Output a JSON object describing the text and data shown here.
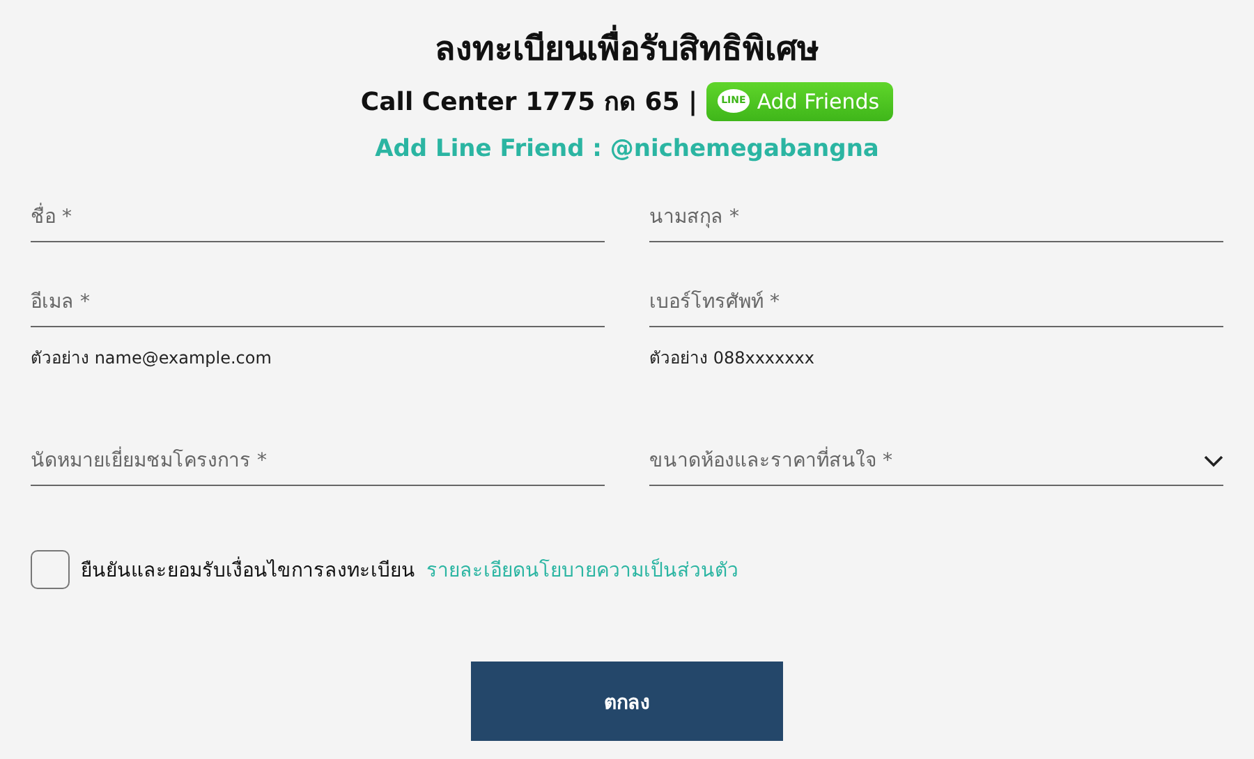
{
  "header": {
    "title": "ลงทะเบียนเพื่อรับสิทธิพิเศษ",
    "call_center": "Call Center 1775 กด 65 |",
    "line_button": {
      "logo": "LINE",
      "label": "Add Friends"
    },
    "line_id": "Add Line Friend : @nichemegabangna"
  },
  "fields": [
    {
      "kind": "text",
      "placeholder": "ชื่อ *"
    },
    {
      "kind": "text",
      "placeholder": "นามสกุล *"
    },
    {
      "kind": "text",
      "placeholder": "อีเมล *",
      "hint": "ตัวอย่าง name@example.com"
    },
    {
      "kind": "text",
      "placeholder": "เบอร์โทรศัพท์ *",
      "hint": "ตัวอย่าง 088xxxxxxx"
    },
    {
      "kind": "text",
      "placeholder": "นัดหมายเยี่ยมชมโครงการ *"
    },
    {
      "kind": "select",
      "placeholder": "ขนาดห้องและราคาที่สนใจ *"
    }
  ],
  "consent": {
    "checked": false,
    "label": "ยืนยันและยอมรับเงื่อนไขการลงทะเบียน",
    "link": "รายละเอียดนโยบายความเป็นส่วนตัว"
  },
  "submit": "ตกลง"
}
